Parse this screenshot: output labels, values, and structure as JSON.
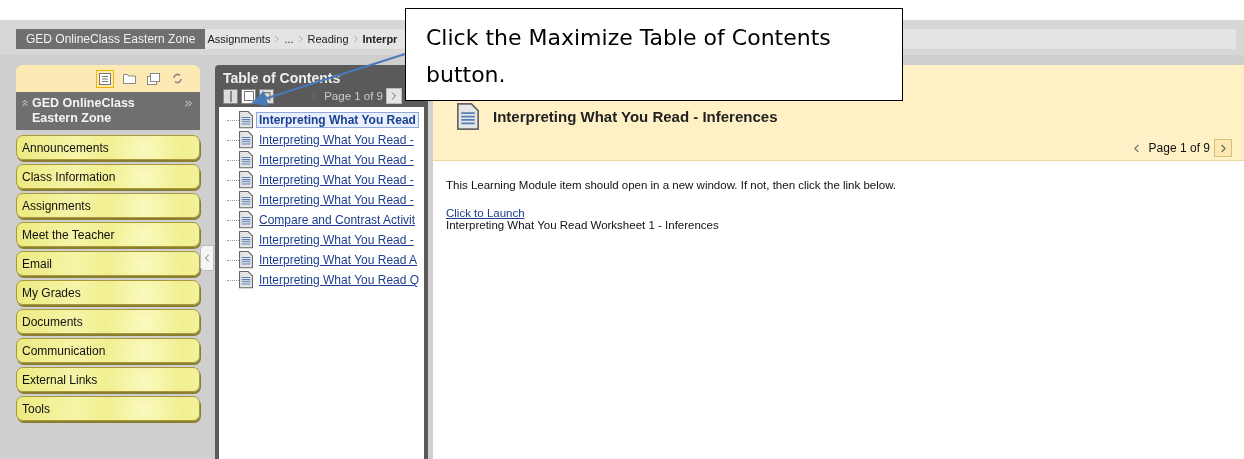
{
  "breadcrumb": {
    "course": "GED OnlineClass Eastern Zone",
    "path": [
      {
        "label": "Assignments",
        "current": false
      },
      {
        "label": "...",
        "current": false
      },
      {
        "label": "Reading",
        "current": false
      },
      {
        "label": "Interpr",
        "current": true
      }
    ]
  },
  "course_menu": {
    "title": "GED OnlineClass Eastern Zone",
    "view_icons": [
      {
        "kind": "list",
        "selected": true
      },
      {
        "kind": "folder",
        "selected": false
      },
      {
        "kind": "windows",
        "selected": false
      },
      {
        "kind": "refresh",
        "selected": false
      }
    ],
    "items": [
      "Announcements",
      "Class Information",
      "Assignments",
      "Meet the Teacher",
      "Email",
      "My Grades",
      "Documents",
      "Communication",
      "External Links",
      "Tools"
    ]
  },
  "toc": {
    "title": "Table of Contents",
    "page": "Page 1 of 9",
    "items": [
      {
        "label": "Interpreting What You Read",
        "selected": true
      },
      {
        "label": "Interpreting What You Read -",
        "selected": false
      },
      {
        "label": "Interpreting What You Read -",
        "selected": false
      },
      {
        "label": "Interpreting What You Read -",
        "selected": false
      },
      {
        "label": "Interpreting What You Read -",
        "selected": false
      },
      {
        "label": "Compare and Contrast Activit",
        "selected": false
      },
      {
        "label": "Interpreting What You Read -",
        "selected": false
      },
      {
        "label": "Interpreting What You Read A",
        "selected": false
      },
      {
        "label": "Interpreting What You Read Q",
        "selected": false
      }
    ]
  },
  "content": {
    "title": "Interpreting What You Read - Inferences",
    "page": "Page 1 of 9",
    "message": "This Learning Module item should open in a new window. If not, then click the link below.",
    "link": "Click to Launch",
    "caption": "Interpreting What You Read Worksheet 1 - Inferences"
  },
  "callout": {
    "text": "Click the Maximize Table of Contents button."
  }
}
